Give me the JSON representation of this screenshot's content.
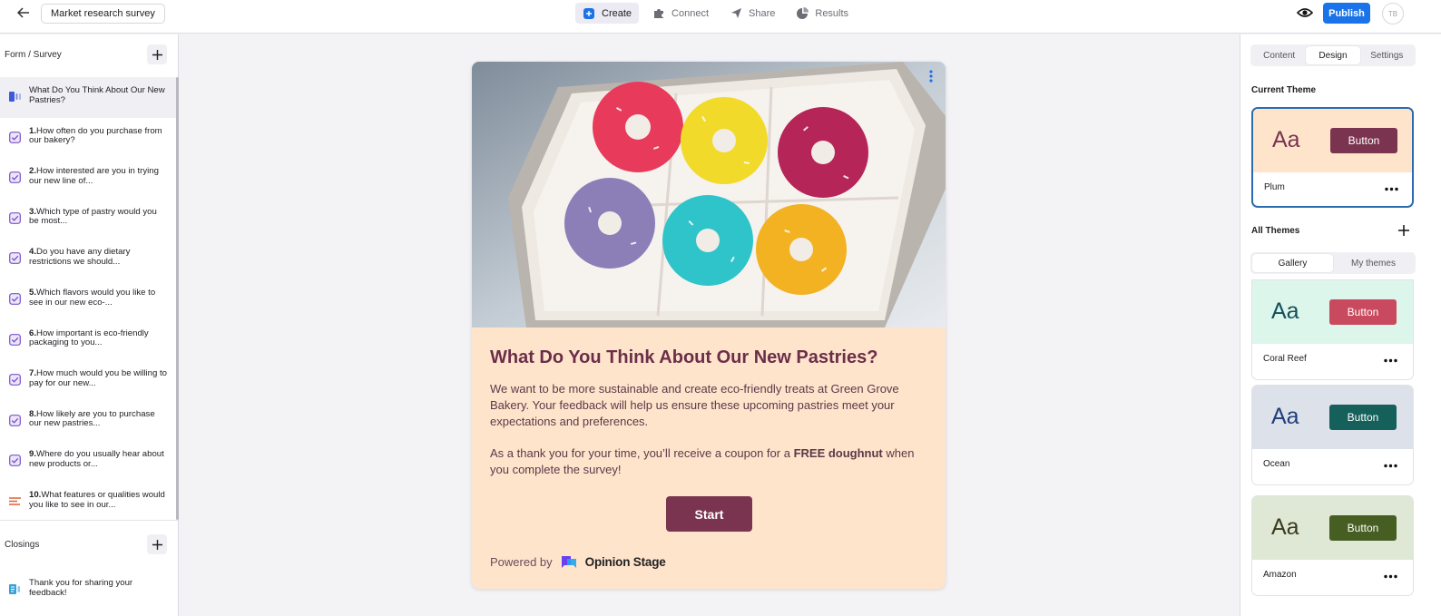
{
  "topbar": {
    "doc_title": "Market research survey",
    "tabs": [
      {
        "label": "Create",
        "icon": "create-icon",
        "active": true
      },
      {
        "label": "Connect",
        "icon": "puzzle-icon",
        "active": false
      },
      {
        "label": "Share",
        "icon": "send-icon",
        "active": false
      },
      {
        "label": "Results",
        "icon": "pie-chart-icon",
        "active": false
      }
    ],
    "publish_label": "Publish",
    "avatar_text": "TB"
  },
  "sidebar": {
    "form_section_label": "Form / Survey",
    "intro": {
      "label": "What Do You Think About Our New Pastries?",
      "icon": "intro-card-icon"
    },
    "questions": [
      {
        "num": "1.",
        "text": "How often do you purchase from our bakery?",
        "icon": "checkbox-icon"
      },
      {
        "num": "2.",
        "text": "How interested are you in trying our new line of...",
        "icon": "checkbox-icon"
      },
      {
        "num": "3.",
        "text": "Which type of pastry would you be most...",
        "icon": "checkbox-icon"
      },
      {
        "num": "4.",
        "text": "Do you have any dietary restrictions we should...",
        "icon": "checkbox-icon"
      },
      {
        "num": "5.",
        "text": "Which flavors would you like to see in our new eco-...",
        "icon": "checkbox-icon"
      },
      {
        "num": "6.",
        "text": "How important is eco-friendly packaging to you...",
        "icon": "checkbox-icon"
      },
      {
        "num": "7.",
        "text": "How much would you be willing to pay for our new...",
        "icon": "checkbox-icon"
      },
      {
        "num": "8.",
        "text": "How likely are you to purchase our new pastries...",
        "icon": "checkbox-icon"
      },
      {
        "num": "9.",
        "text": "Where do you usually hear about new products or...",
        "icon": "checkbox-icon"
      },
      {
        "num": "10.",
        "text": "What features or qualities would you like to see in our...",
        "icon": "open-text-icon"
      }
    ],
    "closings_label": "Closings",
    "closing": {
      "label": "Thank you for sharing your feedback!",
      "icon": "closing-card-icon"
    }
  },
  "card": {
    "title": "What Do You Think About Our New Pastries?",
    "desc1": "We want to be more sustainable and create eco-friendly treats at Green Grove Bakery. Your feedback will help us ensure these upcoming pastries meet your expectations and preferences.",
    "desc2_pre": "As a thank you for your time, you’ll receive a coupon for a ",
    "desc2_bold": "FREE doughnut",
    "desc2_post": " when you complete the survey!",
    "start_label": "Start",
    "powered_by": "Powered by",
    "brand": "Opinion Stage"
  },
  "right_panel": {
    "tabs": [
      "Content",
      "Design",
      "Settings"
    ],
    "active_tab": "Design",
    "current_theme_label": "Current Theme",
    "current_theme": {
      "name": "Plum",
      "aa": "Aa",
      "button": "Button",
      "bg": "#ffe4cc",
      "aa_color": "#7a344f",
      "btn_color": "#7a344f"
    },
    "all_themes_label": "All Themes",
    "gallery_tabs": [
      "Gallery",
      "My themes"
    ],
    "themes": [
      {
        "name": "Coral Reef",
        "aa": "Aa",
        "button": "Button",
        "bg": "#ddf6ec",
        "aa_color": "#14505a",
        "btn_color": "#c94a5e"
      },
      {
        "name": "Ocean",
        "aa": "Aa",
        "button": "Button",
        "bg": "#dde1ea",
        "aa_color": "#1f3f7a",
        "btn_color": "#15605a"
      },
      {
        "name": "Amazon",
        "aa": "Aa",
        "button": "Button",
        "bg": "#dfe8d4",
        "aa_color": "#3a3a1e",
        "btn_color": "#465e22"
      }
    ]
  },
  "colors": {
    "accent": "#1a73e8",
    "plum": "#7a344f",
    "cream": "#ffe4cc"
  }
}
